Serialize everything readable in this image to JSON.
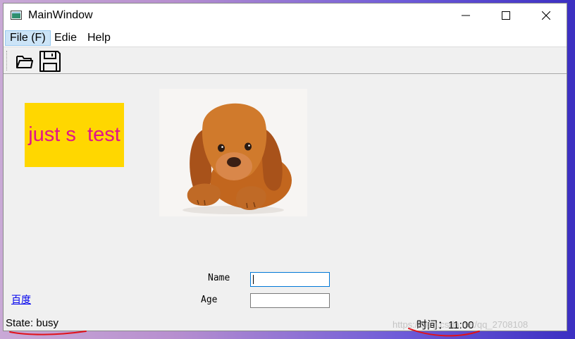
{
  "window": {
    "title": "MainWindow"
  },
  "menubar": {
    "items": [
      "File (F)",
      "Edie",
      "Help"
    ]
  },
  "toolbar": {
    "open_icon": "folder-open-icon",
    "save_icon": "floppy-save-icon"
  },
  "content": {
    "label_text": "just s  test",
    "label_bg": "#ffd700",
    "label_color": "#e0168a",
    "image_subject": "puppy-photo",
    "form": {
      "name_label": "Name",
      "name_value": "",
      "age_label": "Age",
      "age_value": ""
    },
    "link_text": "百度"
  },
  "statusbar": {
    "state_text": "State: busy",
    "time_text": "时间：11:00"
  },
  "watermark": "https://blog.csdn.net/qq_2708108"
}
